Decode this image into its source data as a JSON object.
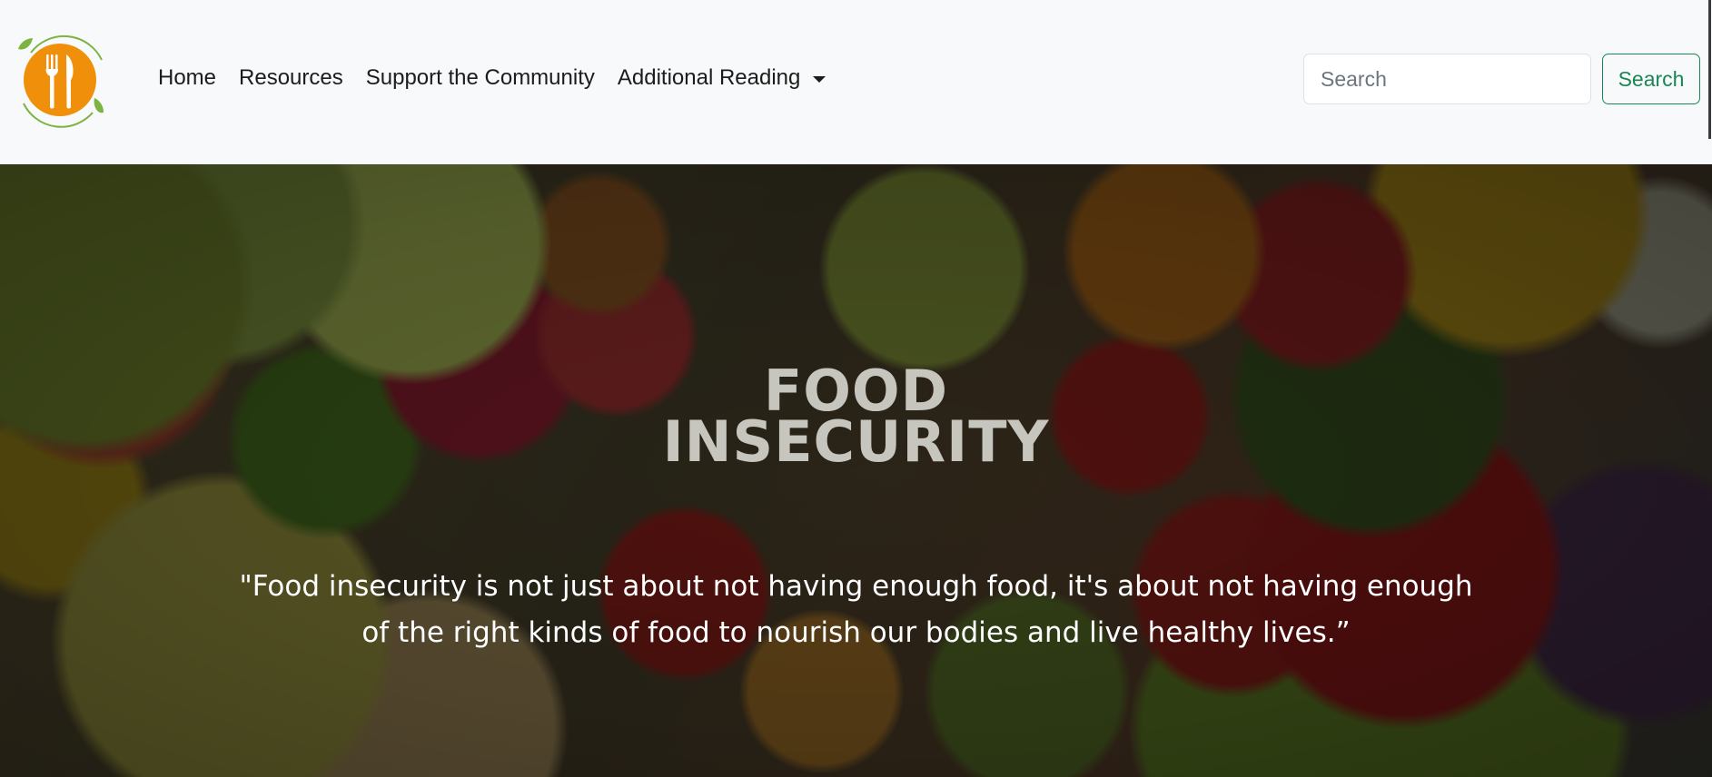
{
  "nav": {
    "logo_icon": "fork-knife-plate-icon",
    "links": [
      {
        "label": "Home"
      },
      {
        "label": "Resources"
      },
      {
        "label": "Support the Community"
      },
      {
        "label": "Additional Reading"
      }
    ]
  },
  "search": {
    "placeholder": "Search",
    "value": "",
    "button_label": "Search"
  },
  "hero": {
    "title_line1": "FOOD",
    "title_line2": "INSECURITY",
    "quote": "\"Food insecurity is not just about not having enough food, it's about not having enough of the right kinds of food to nourish our bodies and live healthy lives.”"
  },
  "colors": {
    "navbar_bg": "#f8f9fa",
    "logo_orange": "#f0900a",
    "logo_leaf_green": "#7cb342",
    "search_button": "#198754"
  }
}
